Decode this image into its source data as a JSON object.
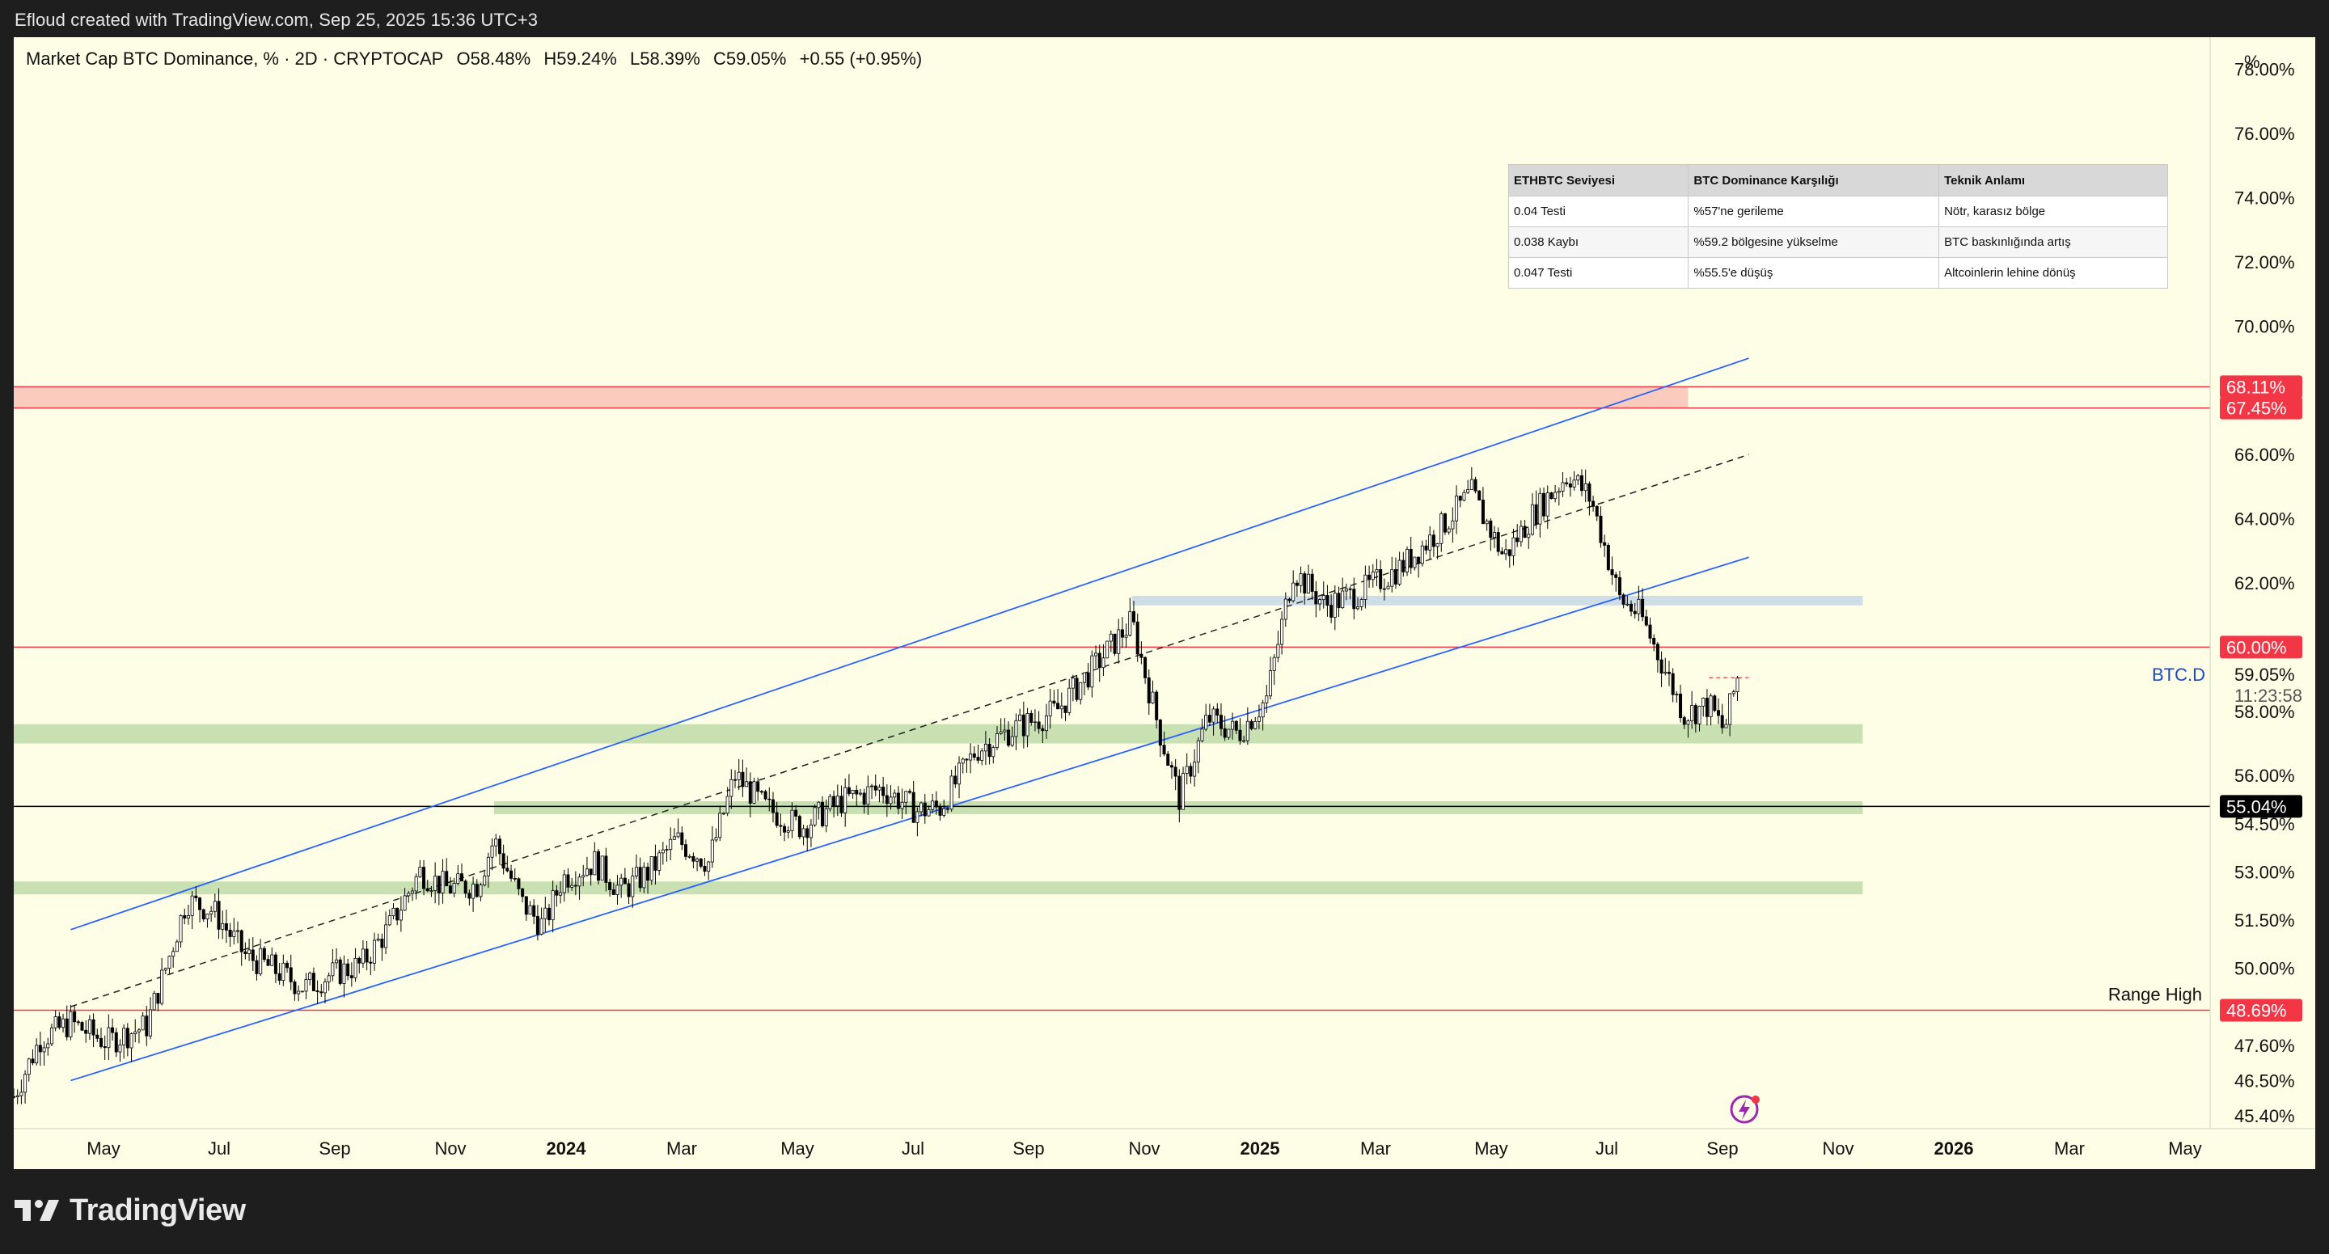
{
  "attribution": "Efloud created with TradingView.com, Sep 25, 2025 15:36 UTC+3",
  "header": {
    "symbol": "Market Cap BTC Dominance, % · 2D · CRYPTOCAP",
    "open": "O58.48%",
    "high": "H59.24%",
    "low": "L58.39%",
    "close": "C59.05%",
    "change": "+0.55 (+0.95%)"
  },
  "price_scale": {
    "unit": "%",
    "ticks": [
      "78.00%",
      "76.00%",
      "74.00%",
      "72.00%",
      "70.00%",
      "66.00%",
      "64.00%",
      "62.00%",
      "58.00%",
      "56.00%",
      "54.50%",
      "53.00%",
      "51.50%",
      "50.00%",
      "47.60%",
      "46.50%",
      "45.40%"
    ]
  },
  "markers": [
    {
      "label": "68.11%",
      "value": 68.11,
      "color": "#f23645",
      "text_color": "#ffffff"
    },
    {
      "label": "67.45%",
      "value": 67.45,
      "color": "#f23645",
      "text_color": "#ffffff"
    },
    {
      "label": "60.00%",
      "value": 60.0,
      "color": "#f23645",
      "text_color": "#ffffff"
    },
    {
      "label": "55.04%",
      "value": 55.04,
      "color": "#000000",
      "text_color": "#ffffff"
    },
    {
      "label": "48.69%",
      "value": 48.69,
      "color": "#f23645",
      "text_color": "#ffffff"
    }
  ],
  "current_price": {
    "label": "59.05%",
    "countdown": "11:23:58",
    "symbol_tag": "BTC.D"
  },
  "time_axis": [
    {
      "label": "May",
      "bold": false
    },
    {
      "label": "Jul",
      "bold": false
    },
    {
      "label": "Sep",
      "bold": false
    },
    {
      "label": "Nov",
      "bold": false
    },
    {
      "label": "2024",
      "bold": true
    },
    {
      "label": "Mar",
      "bold": false
    },
    {
      "label": "May",
      "bold": false
    },
    {
      "label": "Jul",
      "bold": false
    },
    {
      "label": "Sep",
      "bold": false
    },
    {
      "label": "Nov",
      "bold": false
    },
    {
      "label": "2025",
      "bold": true
    },
    {
      "label": "Mar",
      "bold": false
    },
    {
      "label": "May",
      "bold": false
    },
    {
      "label": "Jul",
      "bold": false
    },
    {
      "label": "Sep",
      "bold": false
    },
    {
      "label": "Nov",
      "bold": false
    },
    {
      "label": "2026",
      "bold": true
    },
    {
      "label": "Mar",
      "bold": false
    },
    {
      "label": "May",
      "bold": false
    }
  ],
  "annotation_range_high": "Range High",
  "table": {
    "headers": [
      "ETHBTC Seviyesi",
      "BTC Dominance Karşılığı",
      "Teknik Anlamı"
    ],
    "rows": [
      [
        "0.04 Testi",
        "%57'ne gerileme",
        "Nötr, karasız bölge"
      ],
      [
        "0.038 Kaybı",
        "%59.2 bölgesine yükselme",
        "BTC baskınlığında artış"
      ],
      [
        "0.047 Testi",
        "%55.5'e düşüş",
        "Altcoinlerin lehine dönüş"
      ]
    ]
  },
  "brand": "TradingView",
  "chart_data": {
    "type": "candlestick",
    "timeframe": "2D",
    "ylim": [
      45.0,
      79.0
    ],
    "x_start": "2023-04-01",
    "x_end": "2026-06-01",
    "close_path": [
      [
        "2023-04-01",
        46.0
      ],
      [
        "2023-04-15",
        47.8
      ],
      [
        "2023-05-01",
        48.3
      ],
      [
        "2023-05-20",
        47.7
      ],
      [
        "2023-06-10",
        48.2
      ],
      [
        "2023-06-20",
        50.0
      ],
      [
        "2023-07-01",
        52.1
      ],
      [
        "2023-07-15",
        51.8
      ],
      [
        "2023-08-01",
        50.4
      ],
      [
        "2023-08-15",
        50.0
      ],
      [
        "2023-09-01",
        49.4
      ],
      [
        "2023-09-15",
        49.8
      ],
      [
        "2023-10-01",
        50.1
      ],
      [
        "2023-10-15",
        51.2
      ],
      [
        "2023-11-01",
        53.0
      ],
      [
        "2023-11-15",
        52.5
      ],
      [
        "2023-12-01",
        52.6
      ],
      [
        "2023-12-10",
        54.0
      ],
      [
        "2023-12-25",
        52.0
      ],
      [
        "2024-01-05",
        51.3
      ],
      [
        "2024-01-15",
        52.8
      ],
      [
        "2024-02-01",
        53.3
      ],
      [
        "2024-02-15",
        52.4
      ],
      [
        "2024-03-01",
        53.0
      ],
      [
        "2024-03-15",
        54.0
      ],
      [
        "2024-04-01",
        53.3
      ],
      [
        "2024-04-15",
        56.0
      ],
      [
        "2024-05-01",
        55.0
      ],
      [
        "2024-05-20",
        54.4
      ],
      [
        "2024-06-10",
        55.2
      ],
      [
        "2024-07-01",
        55.6
      ],
      [
        "2024-07-20",
        54.9
      ],
      [
        "2024-08-01",
        55.0
      ],
      [
        "2024-08-20",
        56.8
      ],
      [
        "2024-09-10",
        57.5
      ],
      [
        "2024-10-01",
        58.0
      ],
      [
        "2024-10-20",
        59.3
      ],
      [
        "2024-11-10",
        60.8
      ],
      [
        "2024-11-25",
        57.3
      ],
      [
        "2024-12-05",
        55.3
      ],
      [
        "2024-12-20",
        57.8
      ],
      [
        "2025-01-05",
        57.3
      ],
      [
        "2025-01-20",
        58.4
      ],
      [
        "2025-02-03",
        62.4
      ],
      [
        "2025-02-20",
        61.3
      ],
      [
        "2025-03-10",
        61.7
      ],
      [
        "2025-04-01",
        62.5
      ],
      [
        "2025-04-20",
        63.6
      ],
      [
        "2025-05-08",
        64.8
      ],
      [
        "2025-05-25",
        62.8
      ],
      [
        "2025-06-10",
        64.2
      ],
      [
        "2025-06-28",
        65.4
      ],
      [
        "2025-07-10",
        64.6
      ],
      [
        "2025-07-25",
        61.5
      ],
      [
        "2025-08-05",
        61.0
      ],
      [
        "2025-08-20",
        59.0
      ],
      [
        "2025-08-28",
        57.9
      ],
      [
        "2025-09-10",
        58.2
      ],
      [
        "2025-09-18",
        57.4
      ],
      [
        "2025-09-25",
        59.05
      ]
    ],
    "last": {
      "open": 58.48,
      "high": 59.24,
      "low": 58.39,
      "close": 59.05,
      "change": 0.55,
      "change_pct": 0.95
    },
    "horizontal_lines": [
      68.11,
      67.45,
      60.0,
      55.04,
      48.69
    ],
    "zones": [
      {
        "color": "red",
        "from": 67.45,
        "to": 68.11,
        "start": "2023-04-01",
        "end": "2025-08-30"
      },
      {
        "color": "blue",
        "from": 61.3,
        "to": 61.6,
        "start": "2024-11-10",
        "end": "2025-11-30"
      },
      {
        "color": "green",
        "from": 57.0,
        "to": 57.6,
        "start": "2023-04-01",
        "end": "2025-11-30"
      },
      {
        "color": "green",
        "from": 54.8,
        "to": 55.2,
        "start": "2023-12-10",
        "end": "2025-11-30"
      },
      {
        "color": "green",
        "from": 52.3,
        "to": 52.7,
        "start": "2023-04-01",
        "end": "2025-11-30"
      }
    ],
    "channel": {
      "upper": [
        [
          "2023-05-01",
          51.2
        ],
        [
          "2025-10-01",
          69.0
        ]
      ],
      "lower": [
        [
          "2023-05-01",
          46.5
        ],
        [
          "2025-10-01",
          62.8
        ]
      ],
      "middle": [
        [
          "2023-05-01",
          48.8
        ],
        [
          "2025-10-01",
          66.0
        ]
      ]
    }
  }
}
